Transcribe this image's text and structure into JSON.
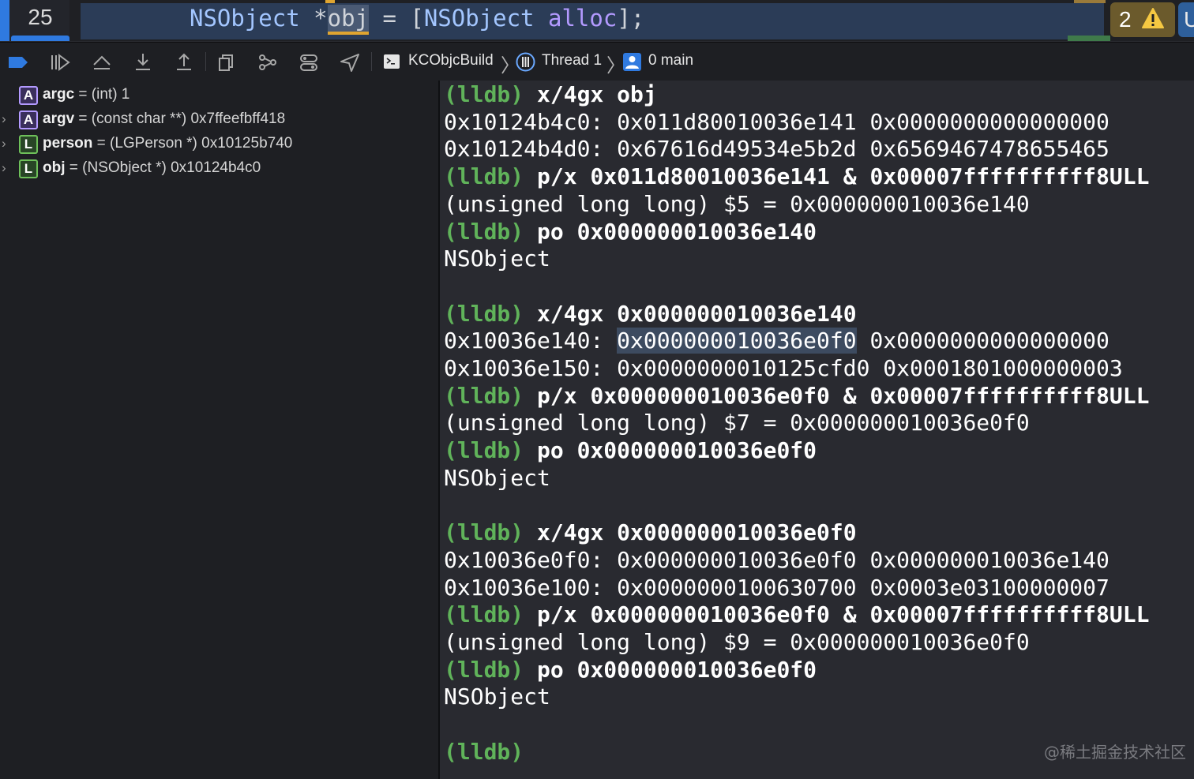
{
  "editor": {
    "line_number": "25",
    "code_type": "NSObject",
    "code_ptr": " *",
    "code_var": "obj",
    "code_mid": " = [",
    "code_cls2": "NSObject",
    "code_space": " ",
    "code_fn": "alloc",
    "code_end": "];",
    "warning_count": "2",
    "right_char": "U",
    "colors": {
      "selection": "#2b3c57",
      "accent": "#2f7ae0",
      "warning": "#e0a530"
    }
  },
  "toolbar": {
    "icons": [
      "breakpoints-toggle-icon",
      "continue-icon",
      "step-over-icon",
      "step-into-icon",
      "step-out-icon",
      "view-hierarchy-icon",
      "memory-graph-icon",
      "environment-overrides-icon",
      "simulate-location-icon"
    ],
    "breadcrumbs": [
      "KCObjcBuild",
      "Thread 1",
      "0 main"
    ]
  },
  "variables": [
    {
      "badge": "A",
      "name": "argc",
      "rest": " = (int) 1",
      "expandable": false
    },
    {
      "badge": "A",
      "name": "argv",
      "rest": " = (const char **) 0x7ffeefbff418",
      "expandable": true
    },
    {
      "badge": "L",
      "name": "person",
      "rest": " = (LGPerson *) 0x10125b740",
      "expandable": true
    },
    {
      "badge": "L",
      "name": "obj",
      "rest": " = (NSObject *) 0x10124b4c0",
      "expandable": true
    }
  ],
  "console": {
    "prompt": "(lldb)",
    "lines": [
      {
        "type": "cmd",
        "text": "x/4gx obj"
      },
      {
        "type": "out",
        "text": "0x10124b4c0: 0x011d80010036e141 0x0000000000000000"
      },
      {
        "type": "out",
        "text": "0x10124b4d0: 0x67616d49534e5b2d 0x6569467478655465"
      },
      {
        "type": "cmd",
        "text": "p/x 0x011d80010036e141 & 0x00007ffffffffff8ULL"
      },
      {
        "type": "out",
        "text": "(unsigned long long) $5 = 0x000000010036e140"
      },
      {
        "type": "cmd",
        "text": "po 0x000000010036e140"
      },
      {
        "type": "out",
        "text": "NSObject"
      },
      {
        "type": "blank",
        "text": ""
      },
      {
        "type": "cmd",
        "text": "x/4gx 0x000000010036e140"
      },
      {
        "type": "out_hl",
        "pre": "0x10036e140: ",
        "hl": "0x000000010036e0f0",
        "post": " 0x0000000000000000"
      },
      {
        "type": "out",
        "text": "0x10036e150: 0x0000000010125cfd0 0x0001801000000003"
      },
      {
        "type": "cmd",
        "text": "p/x 0x000000010036e0f0 & 0x00007ffffffffff8ULL"
      },
      {
        "type": "out",
        "text": "(unsigned long long) $7 = 0x000000010036e0f0"
      },
      {
        "type": "cmd",
        "text": "po 0x000000010036e0f0"
      },
      {
        "type": "out",
        "text": "NSObject"
      },
      {
        "type": "blank",
        "text": ""
      },
      {
        "type": "cmd",
        "text": "x/4gx 0x000000010036e0f0"
      },
      {
        "type": "out",
        "text": "0x10036e0f0: 0x000000010036e0f0 0x000000010036e140"
      },
      {
        "type": "out",
        "text": "0x10036e100: 0x0000000100630700 0x0003e03100000007"
      },
      {
        "type": "cmd",
        "text": "p/x 0x000000010036e0f0 & 0x00007ffffffffff8ULL"
      },
      {
        "type": "out",
        "text": "(unsigned long long) $9 = 0x000000010036e0f0"
      },
      {
        "type": "cmd",
        "text": "po 0x000000010036e0f0"
      },
      {
        "type": "out",
        "text": "NSObject"
      },
      {
        "type": "blank",
        "text": ""
      },
      {
        "type": "prompt_only",
        "text": ""
      }
    ]
  },
  "watermark": "@稀土掘金技术社区"
}
